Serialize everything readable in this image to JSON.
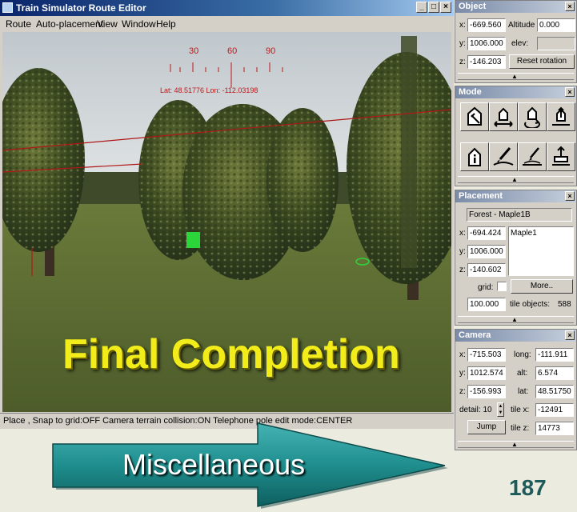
{
  "window": {
    "title": "Train Simulator Route Editor",
    "controls": [
      "_",
      "□",
      "×"
    ]
  },
  "menu": [
    "Route",
    "Auto-placement",
    "View",
    "Window",
    "Help"
  ],
  "compass": {
    "ticks": [
      "30",
      "60",
      "90"
    ],
    "readout": "Lat: 48.51776 Lon: -112.03198"
  },
  "overlay_title": "Final Completion",
  "status_bar": "Place , Snap to grid:OFF Camera terrain collision:ON Telephone pole edit mode:CENTER",
  "object_panel": {
    "title": "Object",
    "x_label": "x:",
    "x_value": "-669.560",
    "y_label": "y:",
    "y_value": "1006.000",
    "z_label": "z:",
    "z_value": "-146.203",
    "altitude_label": "Altitude",
    "altitude_value": "0.000",
    "elev_label": "elev:",
    "elev_value": "",
    "reset_button": "Reset rotation"
  },
  "mode_panel": {
    "title": "Mode",
    "icons": [
      "place-object-icon",
      "move-object-icon",
      "rotate-object-icon",
      "raise-object-icon",
      "info-icon",
      "brush-terrain-icon",
      "pencil-terrain-icon",
      "elevate-icon"
    ]
  },
  "placement_panel": {
    "title": "Placement",
    "object_name": "Forest - Maple1B",
    "x_label": "x:",
    "x_value": "-694.424",
    "y_label": "y:",
    "y_value": "1006.000",
    "z_label": "z:",
    "z_value": "-140.602",
    "list_items": [
      "Maple1"
    ],
    "grid_label": "grid:",
    "grid_checked": false,
    "more_button": "More..",
    "grid_size": "100.000",
    "tile_objects_label": "tile objects:",
    "tile_objects_value": "588"
  },
  "camera_panel": {
    "title": "Camera",
    "x_label": "x:",
    "x_value": "-715.503",
    "y_label": "y:",
    "y_value": "1012.574",
    "z_label": "z:",
    "z_value": "-156.993",
    "long_label": "long:",
    "long_value": "-111.911",
    "alt_label": "alt:",
    "alt_value": "6.574",
    "lat_label": "lat:",
    "lat_value": "48.51750",
    "detail_label": "detail: 10",
    "tilex_label": "tile x:",
    "tilex_value": "-12491",
    "tilez_label": "tile z:",
    "tilez_value": "14773",
    "jump_button": "Jump"
  },
  "banner": {
    "label": "Miscellaneous",
    "page_number": "187",
    "arrow_color": "#1f8e8e"
  }
}
